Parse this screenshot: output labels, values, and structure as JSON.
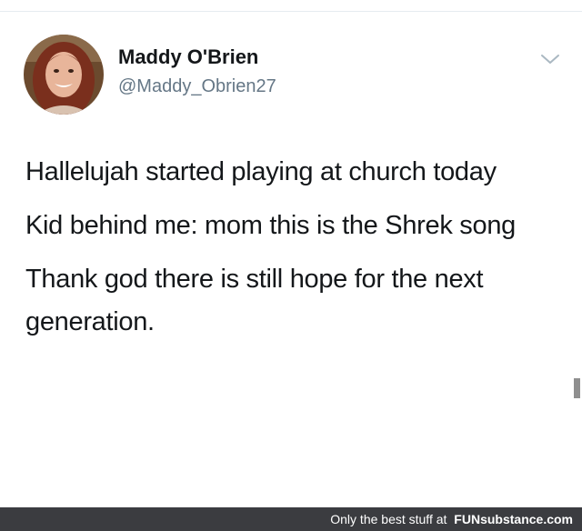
{
  "tweet": {
    "author_name": "Maddy O'Brien",
    "author_handle": "@Maddy_Obrien27",
    "avatar_icon": "profile-photo",
    "menu_icon": "chevron-down-icon",
    "paragraphs": [
      "Hallelujah started playing at church today",
      "Kid behind me: mom this is the Shrek song",
      "Thank god there is still hope for the next generation."
    ]
  },
  "footer": {
    "text": "Only the best stuff at",
    "brand": "FUNsubstance.com"
  },
  "colors": {
    "text": "#14171a",
    "handle": "#657786",
    "footer_bg": "#3b3c40"
  }
}
